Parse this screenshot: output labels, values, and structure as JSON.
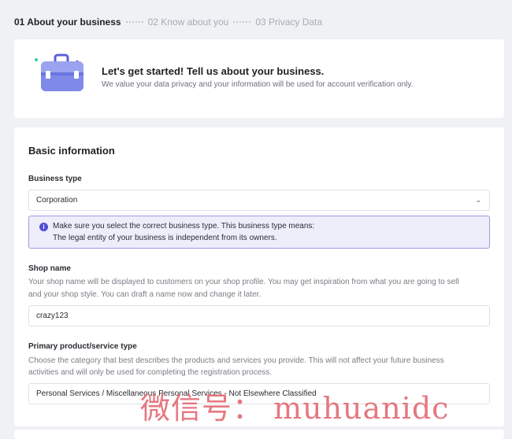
{
  "steps": [
    {
      "label": "01 About your business"
    },
    {
      "label": "02 Know about you"
    },
    {
      "label": "03 Privacy Data"
    }
  ],
  "hero": {
    "title": "Let's get started! Tell us about your business.",
    "subtitle": "We value your data privacy and your information will be used for account verification only."
  },
  "form": {
    "section_title": "Basic information",
    "business_type": {
      "label": "Business type",
      "value": "Corporation",
      "info_line1": "Make sure you select the correct business type. This business type means:",
      "info_line2": "The legal entity of your business is independent from its owners."
    },
    "shop_name": {
      "label": "Shop name",
      "help_line1": "Your shop name will be displayed to customers on your shop profile. You may get inspiration from what you are going to sell",
      "help_line2": "and your shop style. You can draft a name now and change it later.",
      "value": "crazy123"
    },
    "primary_product": {
      "label": "Primary product/service type",
      "help_line1": "Choose the category that best describes the products and services you provide. This will not affect your future business",
      "help_line2": "activities and will only be used for completing the registration process.",
      "value": "Personal Services / Miscellaneous Personal Services - Not Elsewhere Classified"
    }
  },
  "watermark": "微信号： muhuanidc",
  "colors": {
    "accent": "#4f4fd6",
    "info_bg": "#eeeefb",
    "info_border": "#9b9be0",
    "watermark": "#e36a73"
  }
}
